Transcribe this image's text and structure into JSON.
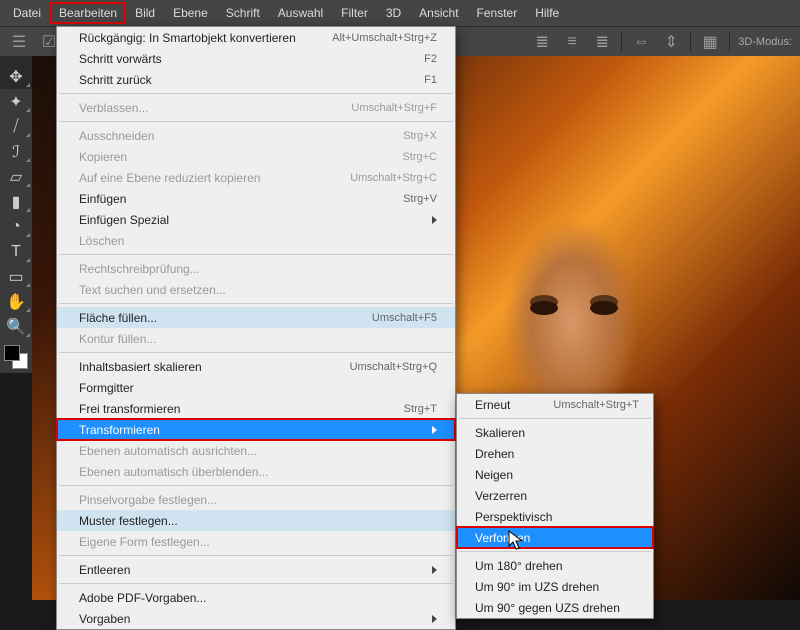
{
  "menubar": {
    "items": [
      "Datei",
      "Bearbeiten",
      "Bild",
      "Ebene",
      "Schrift",
      "Auswahl",
      "Filter",
      "3D",
      "Ansicht",
      "Fenster",
      "Hilfe"
    ],
    "active_index": 1
  },
  "options_bar": {
    "three_d_label": "3D-Modus:"
  },
  "edit_menu": {
    "groups": [
      [
        {
          "label": "Rückgängig: In Smartobjekt konvertieren",
          "shortcut": "Alt+Umschalt+Strg+Z"
        },
        {
          "label": "Schritt vorwärts",
          "shortcut": "F2"
        },
        {
          "label": "Schritt zurück",
          "shortcut": "F1"
        }
      ],
      [
        {
          "label": "Verblassen...",
          "shortcut": "Umschalt+Strg+F",
          "disabled": true
        }
      ],
      [
        {
          "label": "Ausschneiden",
          "shortcut": "Strg+X",
          "disabled": true
        },
        {
          "label": "Kopieren",
          "shortcut": "Strg+C",
          "disabled": true
        },
        {
          "label": "Auf eine Ebene reduziert kopieren",
          "shortcut": "Umschalt+Strg+C",
          "disabled": true
        },
        {
          "label": "Einfügen",
          "shortcut": "Strg+V"
        },
        {
          "label": "Einfügen Spezial",
          "submenu": true
        },
        {
          "label": "Löschen",
          "disabled": true
        }
      ],
      [
        {
          "label": "Rechtschreibprüfung...",
          "disabled": true
        },
        {
          "label": "Text suchen und ersetzen...",
          "disabled": true
        }
      ],
      [
        {
          "label": "Fläche füllen...",
          "shortcut": "Umschalt+F5",
          "hover": true
        },
        {
          "label": "Kontur füllen...",
          "disabled": true
        }
      ],
      [
        {
          "label": "Inhaltsbasiert skalieren",
          "shortcut": "Umschalt+Strg+Q"
        },
        {
          "label": "Formgitter"
        },
        {
          "label": "Frei transformieren",
          "shortcut": "Strg+T"
        },
        {
          "label": "Transformieren",
          "submenu": true,
          "selected": true,
          "boxed": true
        },
        {
          "label": "Ebenen automatisch ausrichten...",
          "disabled": true
        },
        {
          "label": "Ebenen automatisch überblenden...",
          "disabled": true
        }
      ],
      [
        {
          "label": "Pinselvorgabe festlegen...",
          "disabled": true
        },
        {
          "label": "Muster festlegen...",
          "hover": true
        },
        {
          "label": "Eigene Form festlegen...",
          "disabled": true
        }
      ],
      [
        {
          "label": "Entleeren",
          "submenu": true
        }
      ],
      [
        {
          "label": "Adobe PDF-Vorgaben..."
        },
        {
          "label": "Vorgaben",
          "submenu": true
        }
      ]
    ]
  },
  "transform_submenu": {
    "groups": [
      [
        {
          "label": "Erneut",
          "shortcut": "Umschalt+Strg+T"
        }
      ],
      [
        {
          "label": "Skalieren"
        },
        {
          "label": "Drehen"
        },
        {
          "label": "Neigen"
        },
        {
          "label": "Verzerren"
        },
        {
          "label": "Perspektivisch"
        },
        {
          "label": "Verformen",
          "selected": true,
          "boxed": true
        }
      ],
      [
        {
          "label": "Um 180° drehen"
        },
        {
          "label": "Um 90° im UZS drehen"
        },
        {
          "label": "Um 90° gegen UZS drehen"
        }
      ]
    ]
  },
  "tools": [
    {
      "name": "move-tool",
      "glyph": "✥"
    },
    {
      "name": "magic-wand-tool",
      "glyph": "✦"
    },
    {
      "name": "eyedropper-tool",
      "glyph": "⧸"
    },
    {
      "name": "brush-tool",
      "glyph": "ℐ"
    },
    {
      "name": "eraser-tool",
      "glyph": "▱"
    },
    {
      "name": "gradient-tool",
      "glyph": "▮"
    },
    {
      "name": "blur-tool",
      "glyph": "◔"
    },
    {
      "name": "type-tool",
      "glyph": "T"
    },
    {
      "name": "shape-tool",
      "glyph": "▭"
    },
    {
      "name": "hand-tool",
      "glyph": "✋"
    },
    {
      "name": "zoom-tool",
      "glyph": "🔍"
    }
  ]
}
